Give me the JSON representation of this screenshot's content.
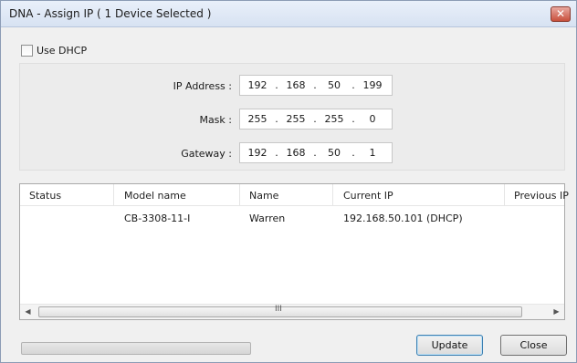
{
  "window": {
    "title": "DNA - Assign IP ( 1 Device Selected )",
    "close_glyph": "✕",
    "close_icon": "close-icon"
  },
  "dhcp": {
    "label": "Use DHCP",
    "checked": false
  },
  "ip": {
    "address_label": "IP Address :",
    "address": [
      "192",
      "168",
      "50",
      "199"
    ],
    "mask_label": "Mask :",
    "mask": [
      "255",
      "255",
      "255",
      "0"
    ],
    "gateway_label": "Gateway :",
    "gateway": [
      "192",
      "168",
      "50",
      "1"
    ],
    "separator": "."
  },
  "table": {
    "columns": [
      "Status",
      "Model name",
      "Name",
      "Current IP",
      "Previous IP"
    ],
    "rows": [
      {
        "status": "",
        "model_name": "CB-3308-11-I",
        "name": "Warren",
        "current_ip": "192.168.50.101 (DHCP)",
        "previous_ip": ""
      }
    ]
  },
  "scrollbar": {
    "left_glyph": "◀",
    "right_glyph": "▶",
    "grip_glyph": "III"
  },
  "progress": {
    "value": 0
  },
  "buttons": {
    "update": "Update",
    "close": "Close"
  }
}
